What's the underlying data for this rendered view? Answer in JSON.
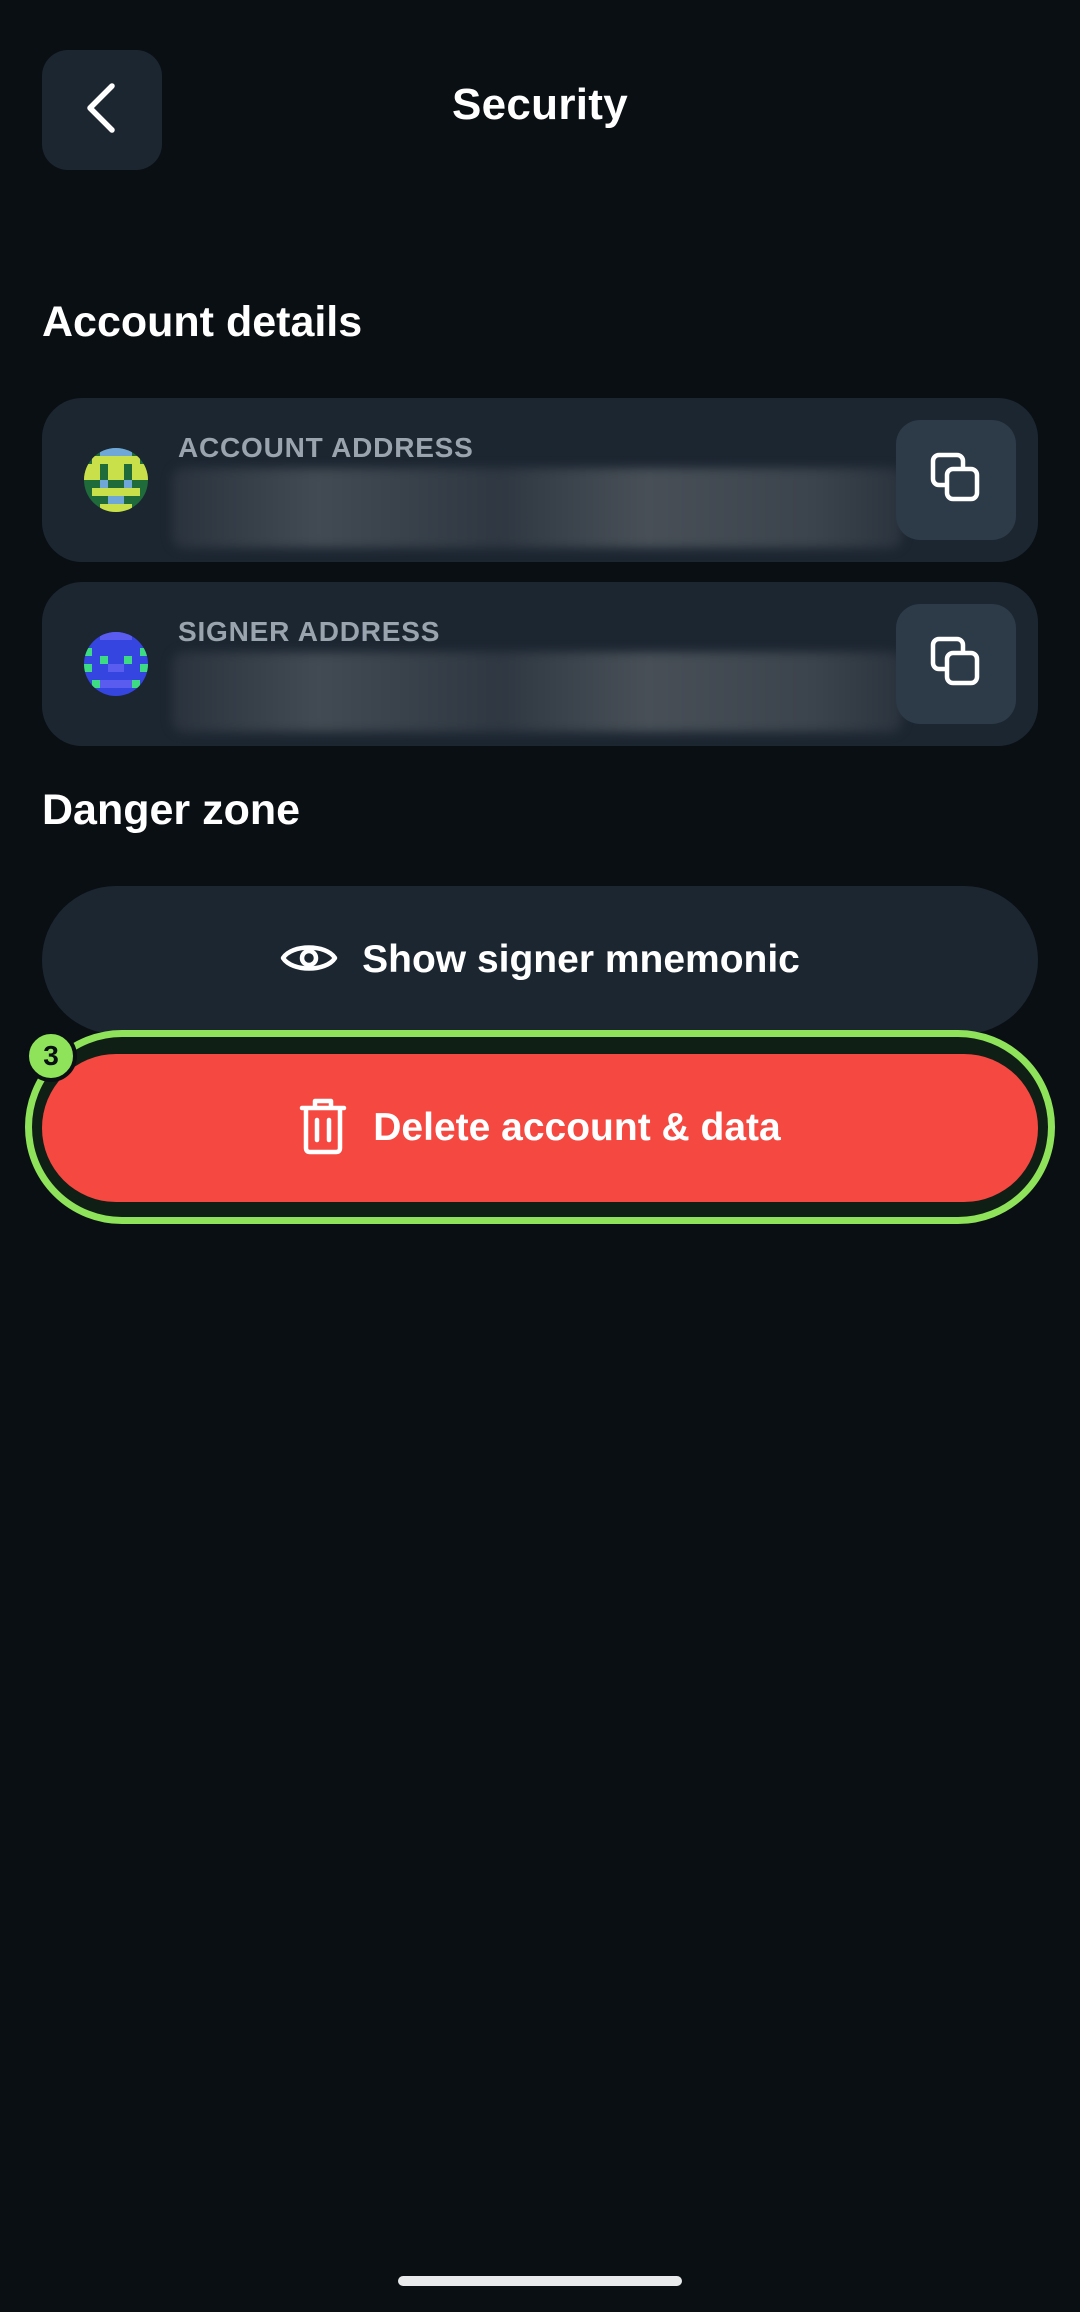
{
  "header": {
    "title": "Security",
    "back_icon": "chevron-left-icon"
  },
  "account_details": {
    "section_title": "Account details",
    "account_address": {
      "label": "ACCOUNT ADDRESS",
      "value_hidden": true,
      "copy_icon": "copy-icon"
    },
    "signer_address": {
      "label": "SIGNER ADDRESS",
      "value_hidden": true,
      "copy_icon": "copy-icon"
    }
  },
  "danger_zone": {
    "section_title": "Danger zone",
    "show_mnemonic": {
      "label": "Show signer mnemonic",
      "icon": "eye-icon"
    },
    "delete_account": {
      "label": "Delete account & data",
      "icon": "trash-icon",
      "step_badge": "3"
    }
  },
  "colors": {
    "background": "#0a0f13",
    "card": "#1c2631",
    "copy_button": "#2d3a48",
    "danger": "#f44840",
    "highlight": "#8fe35a",
    "muted_text": "#9aa4ae"
  }
}
